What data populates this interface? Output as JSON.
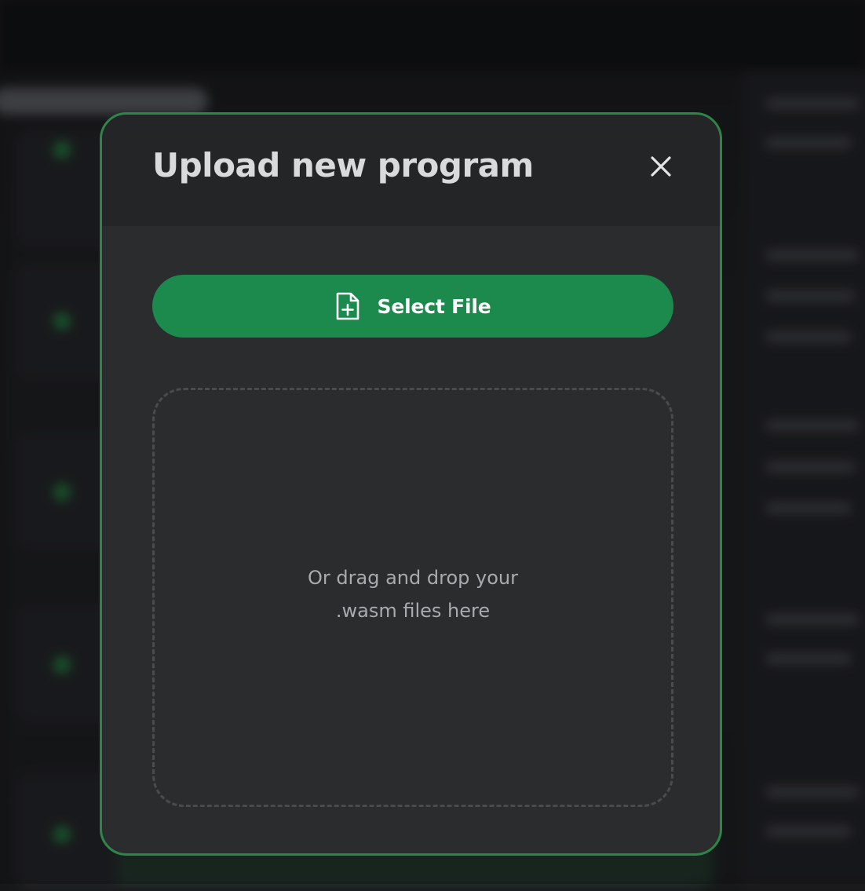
{
  "modal": {
    "title": "Upload new program",
    "close_icon": "close-icon",
    "select_file": {
      "label": "Select File",
      "icon": "file-plus-icon"
    },
    "dropzone": {
      "line1": "Or drag and drop your",
      "line2": ".wasm files here"
    }
  },
  "colors": {
    "accent": "#1b8a4c",
    "modal_border": "#2f8549",
    "modal_background": "#2b2c2e",
    "header_background": "#242527"
  }
}
